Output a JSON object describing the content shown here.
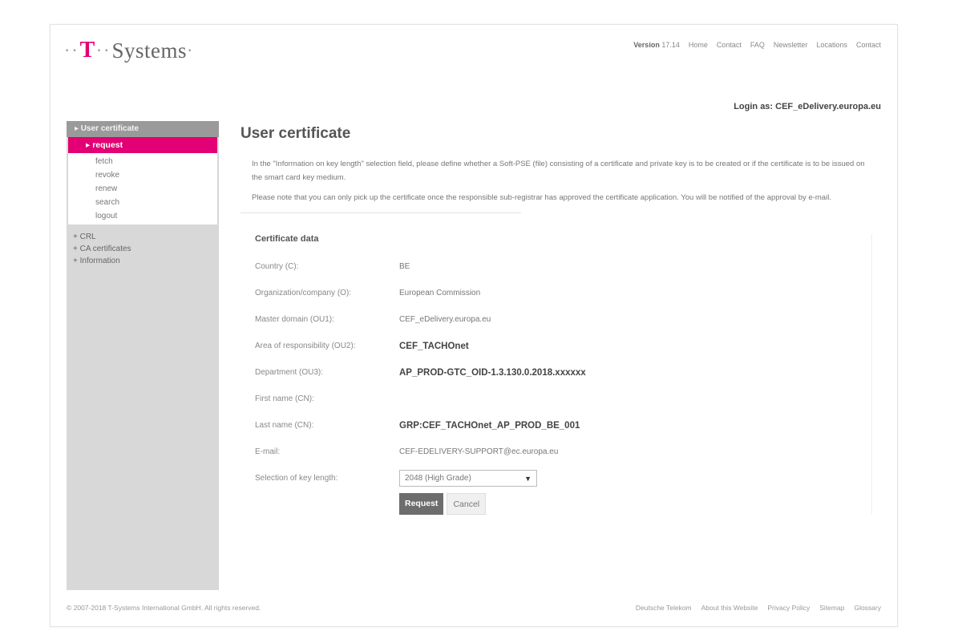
{
  "header": {
    "logo": {
      "dots_left": "··",
      "t": "T",
      "dots_mid": "··",
      "name": "Systems",
      "dot_right": "·"
    },
    "version_label": "Version",
    "version_value": "17.14",
    "nav": [
      "Home",
      "Contact",
      "FAQ",
      "Newsletter",
      "Locations",
      "Contact"
    ],
    "login_info": "Login as: CEF_eDelivery.europa.eu"
  },
  "sidebar": {
    "section_header": "▸ User certificate",
    "active_item": "▸ request",
    "subitems": [
      "fetch",
      "revoke",
      "renew",
      "search",
      "logout"
    ],
    "groups": [
      "+ CRL",
      "+ CA certificates",
      "+ Information"
    ]
  },
  "main": {
    "title": "User certificate",
    "paragraph1": "In the \"Information on key length\" selection field, please define whether a Soft-PSE (file) consisting of a certificate and private key is to be created or if the certificate is to be issued on the smart card key medium.",
    "paragraph2": "Please note that you can only pick up the certificate once the responsible sub-registrar has approved the certificate application. You will be notified of the approval by e-mail.",
    "form": {
      "title": "Certificate data",
      "rows": [
        {
          "label": "Country (C):",
          "value": "BE"
        },
        {
          "label": "Organization/company (O):",
          "value": "European Commission"
        },
        {
          "label": "Master domain (OU1):",
          "value": "CEF_eDelivery.europa.eu"
        },
        {
          "label": "Area of responsibility (OU2):",
          "value": "CEF_TACHOnet"
        },
        {
          "label": "Department (OU3):",
          "value": "AP_PROD-GTC_OID-1.3.130.0.2018.xxxxxx"
        },
        {
          "label": "First name (CN):",
          "value": ""
        },
        {
          "label": "Last name (CN):",
          "value": "GRP:CEF_TACHOnet_AP_PROD_BE_001"
        },
        {
          "label": "E-mail:",
          "value": "CEF-EDELIVERY-SUPPORT@ec.europa.eu"
        }
      ],
      "key_length_label": "Selection of key length:",
      "key_length_selected": "2048 (High Grade)",
      "request_button": "Request",
      "cancel_button": "Cancel"
    }
  },
  "footer": {
    "copyright": "© 2007-2018 T-Systems International GmbH. All rights reserved.",
    "links": [
      "Deutsche Telekom",
      "About this Website",
      "Privacy Policy",
      "Sitemap",
      "Glossary"
    ]
  },
  "colors": {
    "accent": "#e20074",
    "sidebar": "#d8d8d8",
    "sidebar_header": "#9a9a9a",
    "button": "#6d6d6d"
  }
}
